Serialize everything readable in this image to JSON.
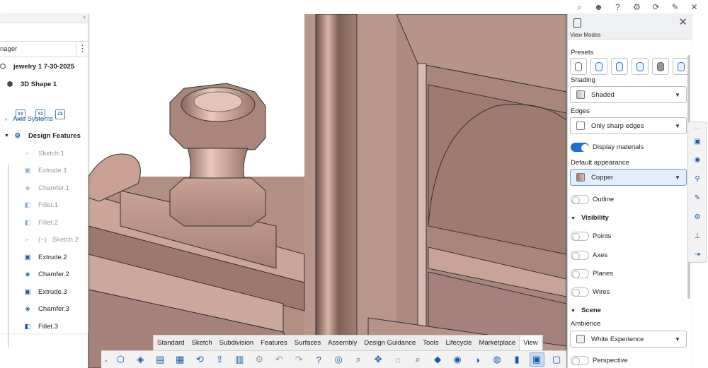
{
  "top_icons": [
    "search-icon",
    "user-icon",
    "help-icon",
    "gear-icon",
    "refresh-icon",
    "pin-icon",
    "close-icon"
  ],
  "tree": {
    "collapse_glyph": "‹",
    "header_label": "nager",
    "kebab_glyph": "⋮",
    "items": [
      {
        "label": "jewelry 1 7-30-2025",
        "style": "bold"
      },
      {
        "label": "3D Shape 1",
        "style": "bold"
      },
      {
        "label": "Axis Systems",
        "style": "blue"
      },
      {
        "label": "Design Features",
        "style": "bold"
      },
      {
        "label": "Sketch.1",
        "style": "dim"
      },
      {
        "label": "Extrude.1",
        "style": "dim"
      },
      {
        "label": "Chamfer.1",
        "style": "dim"
      },
      {
        "label": "Fillet.1",
        "style": "dim"
      },
      {
        "label": "Fillet.2",
        "style": "dim"
      },
      {
        "label": "(−)",
        "style": "dim"
      },
      {
        "label": "Sketch.2",
        "style": "dim"
      },
      {
        "label": "Extrude.2",
        "style": "normal"
      },
      {
        "label": "Chamfer.2",
        "style": "normal"
      },
      {
        "label": "Extrude.3",
        "style": "normal"
      },
      {
        "label": "Chamfer.3",
        "style": "normal"
      },
      {
        "label": "Fillet.3",
        "style": "normal"
      }
    ],
    "axis_icons": [
      "XY",
      "YZ",
      "ZX"
    ]
  },
  "panel": {
    "title": "View Modes",
    "close_glyph": "✕",
    "presets_label": "Presets",
    "shading_label": "Shading",
    "shading_value": "Shaded",
    "edges_label": "Edges",
    "edges_value": "Only sharp edges",
    "display_materials": "Display materials",
    "default_appearance_label": "Default appearance",
    "default_appearance_value": "Copper",
    "outline": "Outline",
    "visibility_section": "Visibility",
    "points": "Points",
    "axes": "Axes",
    "planes": "Planes",
    "wires": "Wires",
    "scene_section": "Scene",
    "ambience_label": "Ambience",
    "ambience_value": "White Experience",
    "perspective": "Perspective",
    "caret": "▼",
    "section_arrow": "▼"
  },
  "tabs": [
    "Standard",
    "Sketch",
    "Subdivision",
    "Features",
    "Surfaces",
    "Assembly",
    "Design Guidance",
    "Tools",
    "Lifecycle",
    "Marketplace",
    "View"
  ],
  "selected_tab": "View",
  "vtool_glyphs": [
    "⋯",
    "▣",
    "◉",
    "⚲",
    "✎",
    "⚙",
    "⊥",
    "⇥"
  ],
  "cmd_glyphs": [
    "⬡",
    "◈",
    "▤",
    "▦",
    "⟲",
    "⇪",
    "▥",
    "⚙",
    "↶",
    "↷",
    "?",
    "◎",
    "⌕",
    "✥",
    "◌",
    "⌕",
    "◆",
    "◉",
    "◑",
    "◍",
    "▮",
    "▣",
    "▢"
  ],
  "expand_glyph": "⌄",
  "colors": {
    "accent": "#1f6ed4",
    "copper": "#b3928a"
  }
}
